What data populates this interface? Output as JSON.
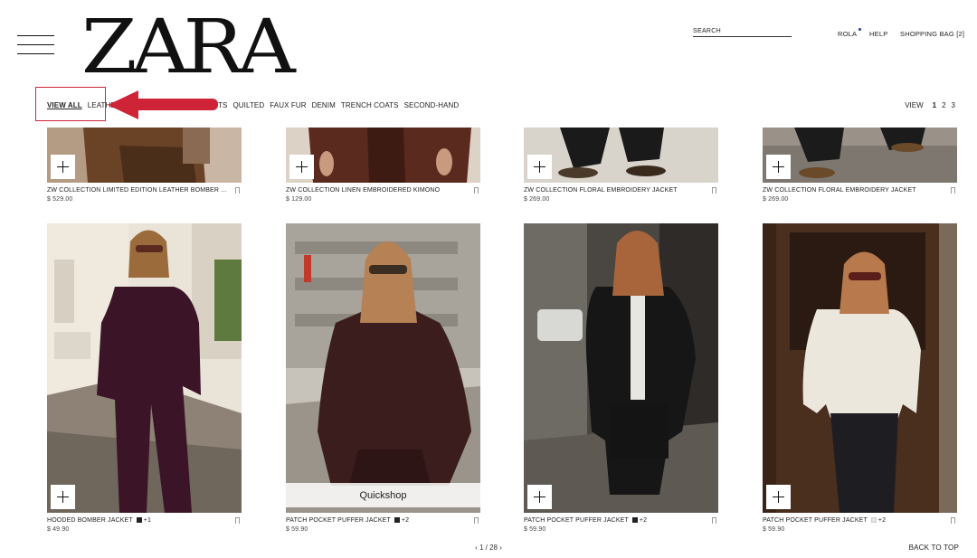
{
  "header": {
    "logo": "ZARA",
    "search_label": "SEARCH",
    "account": "ROLA",
    "help": "HELP",
    "bag": "SHOPPING BAG [2]"
  },
  "categories": [
    {
      "label": "VIEW ALL",
      "active": true
    },
    {
      "label": "LEATHER"
    },
    {
      "label": "JACKETS"
    },
    {
      "label": "QUILTED"
    },
    {
      "label": "FAUX FUR"
    },
    {
      "label": "DENIM"
    },
    {
      "label": "TRENCH COATS"
    },
    {
      "label": "SECOND-HAND"
    }
  ],
  "view": {
    "label": "VIEW",
    "options": [
      "1",
      "2",
      "3"
    ],
    "current": "1"
  },
  "products_top": [
    {
      "name": "ZW COLLECTION LIMITED EDITION LEATHER BOMBER J...",
      "price": "$ 529.00"
    },
    {
      "name": "ZW COLLECTION LINEN EMBROIDERED KIMONO",
      "price": "$ 129.00"
    },
    {
      "name": "ZW COLLECTION FLORAL EMBROIDERY JACKET",
      "price": "$ 269.00"
    },
    {
      "name": "ZW COLLECTION FLORAL EMBROIDERY JACKET",
      "price": "$ 269.00"
    }
  ],
  "products_bottom": [
    {
      "name": "HOODED BOMBER JACKET",
      "colors_extra": "+1",
      "price": "$ 49.90",
      "swatch": "dark"
    },
    {
      "name": "PATCH POCKET PUFFER JACKET",
      "colors_extra": "+2",
      "price": "$ 59.90",
      "swatch": "dark",
      "quickshop": "Quickshop"
    },
    {
      "name": "PATCH POCKET PUFFER JACKET",
      "colors_extra": "+2",
      "price": "$ 59.90",
      "swatch": "dark"
    },
    {
      "name": "PATCH POCKET PUFFER JACKET",
      "colors_extra": "+2",
      "price": "$ 59.90",
      "swatch": "light"
    }
  ],
  "pager": {
    "prev": "‹",
    "text": "1 / 28",
    "next": "›"
  },
  "back_to_top": "BACK TO TOP",
  "colors": {
    "accent_red": "#d22639",
    "text": "#111111"
  }
}
